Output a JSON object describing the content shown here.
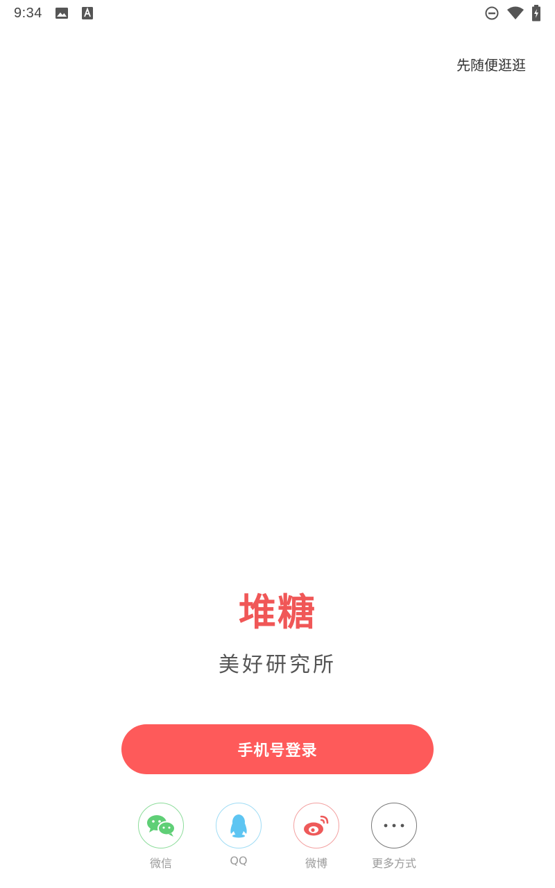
{
  "status_bar": {
    "time": "9:34",
    "left_icons": [
      "image-icon",
      "text-a-icon"
    ],
    "right_icons": [
      "do-not-disturb-icon",
      "wifi-icon",
      "battery-charging-icon"
    ]
  },
  "top_link": {
    "label": "先随便逛逛"
  },
  "brand": {
    "logo_text": "堆糖",
    "slogan": "美好研究所",
    "logo_color": "#f05757"
  },
  "login": {
    "phone_button_label": "手机号登录",
    "button_color": "#fe5a5a"
  },
  "social": [
    {
      "name": "wechat",
      "label": "微信",
      "icon": "wechat-icon",
      "color": "#5fcf76"
    },
    {
      "name": "qq",
      "label": "QQ",
      "icon": "qq-penguin-icon",
      "color": "#5ec5f2"
    },
    {
      "name": "weibo",
      "label": "微博",
      "icon": "weibo-icon",
      "color": "#ee5a5a"
    },
    {
      "name": "more",
      "label": "更多方式",
      "icon": "more-dots-icon",
      "color": "#555555"
    }
  ]
}
